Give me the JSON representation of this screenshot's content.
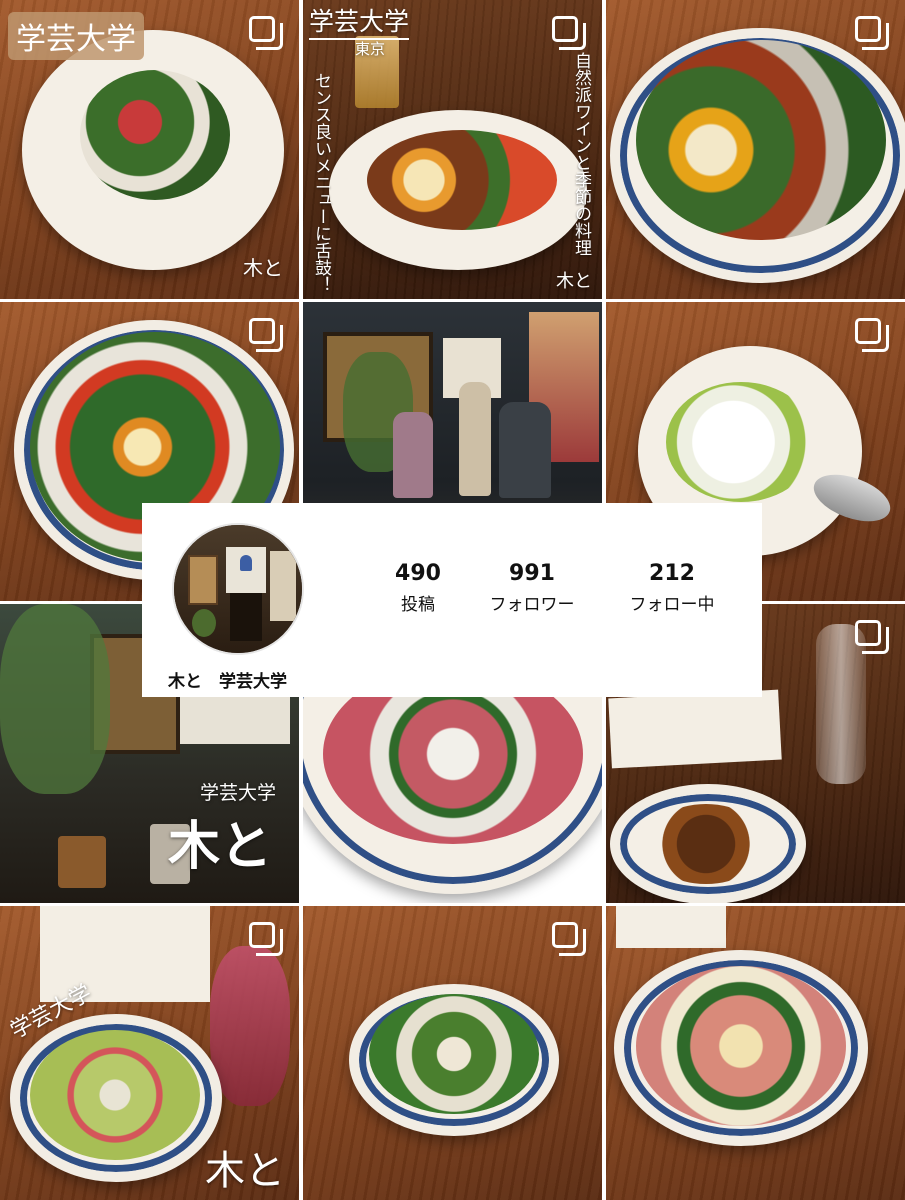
{
  "profile": {
    "name": "木と　学芸大学",
    "stats": [
      {
        "value": "490",
        "label": "投稿"
      },
      {
        "value": "991",
        "label": "フォロワー"
      },
      {
        "value": "212",
        "label": "フォロー中"
      }
    ]
  },
  "tiles": {
    "t1": {
      "tag": "学芸大学",
      "caption": "木と"
    },
    "t2": {
      "title": "学芸大学",
      "subtitle": "東京",
      "vertical_left": "センス良いメニューに舌鼓！",
      "vertical_right": "自然派ワインと季節の料理",
      "caption": "木と"
    },
    "t7": {
      "line1": "学芸大学",
      "line2": "木と"
    },
    "t10": {
      "line1": "学芸大学",
      "caption": "木と"
    }
  },
  "icons": {
    "multi_post": "carousel-icon"
  }
}
